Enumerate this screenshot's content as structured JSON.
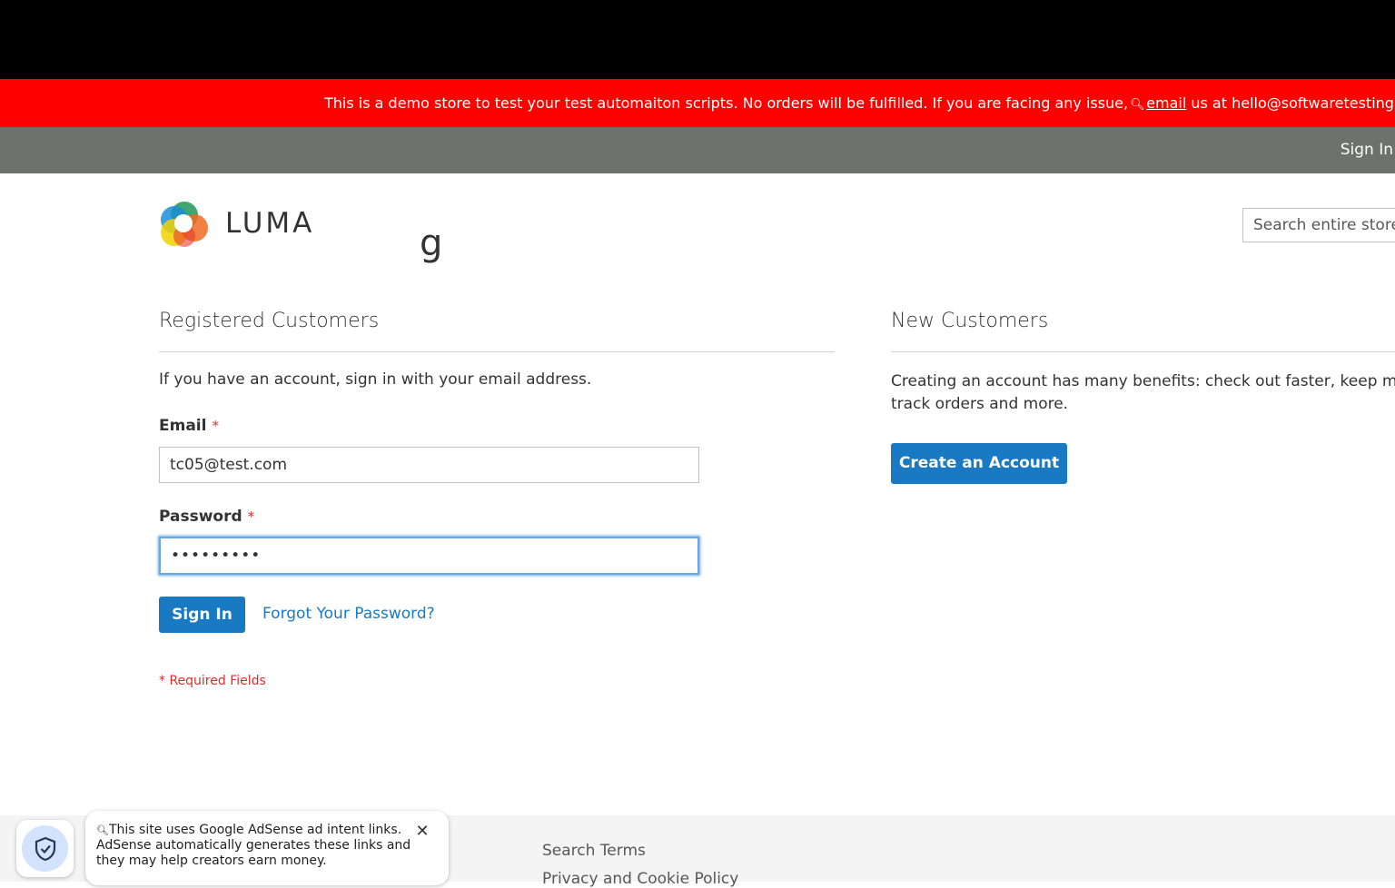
{
  "banner": {
    "text_before": "This is a demo store to test your test automaiton scripts. No orders will be fulfilled. If you are facing any issue,",
    "email_link": "email",
    "text_after": "us at hello@softwaretestingboard.com"
  },
  "header": {
    "sign_in": "Sign In"
  },
  "logo": {
    "text": "LUMA"
  },
  "search": {
    "placeholder": "Search entire store here..."
  },
  "page_title_fragment": "g",
  "registered": {
    "title": "Registered Customers",
    "intro": "If you have an account, sign in with your email address.",
    "email_label": "Email",
    "email_value": "tc05@test.com",
    "password_label": "Password",
    "password_value": "•••••••••",
    "required_mark": "*",
    "sign_in_button": "Sign In",
    "forgot_link": "Forgot Your Password?",
    "required_note": "* Required Fields"
  },
  "new_customers": {
    "title": "New Customers",
    "description_line1": "Creating an account has many benefits: check out faster, keep more",
    "description_line2": "track orders and more.",
    "create_button": "Create an Account"
  },
  "footer": {
    "links": [
      "Search Terms",
      "Privacy and Cookie Policy"
    ]
  },
  "adsense": {
    "line1": "This site uses Google AdSense ad intent links.",
    "line2": "AdSense automatically generates these links and",
    "line3": "they may help creators earn money."
  },
  "colors": {
    "banner_bg": "#ff0000",
    "header_bg": "#6e716e",
    "primary": "#1979c3",
    "required": "#e02b27"
  }
}
